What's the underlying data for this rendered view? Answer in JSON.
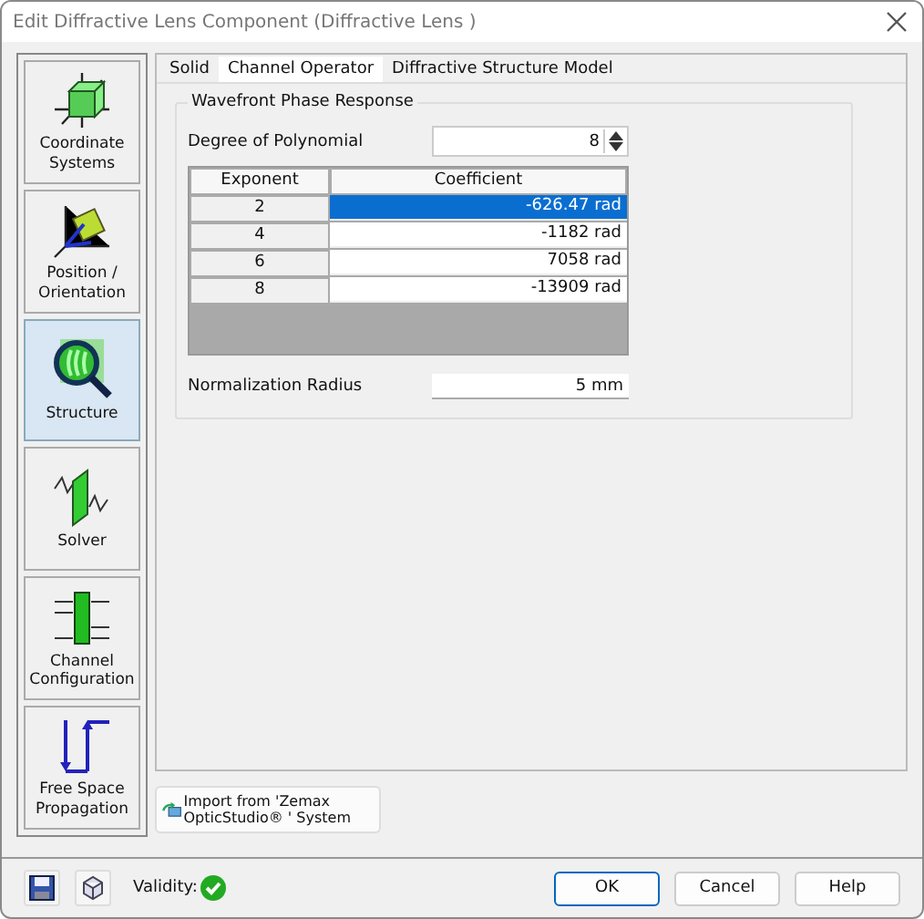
{
  "window": {
    "title": "Edit Diffractive Lens Component (Diffractive Lens )"
  },
  "sidebar": {
    "items": [
      {
        "label": "Coordinate Systems",
        "selected": false
      },
      {
        "label": "Position / Orientation",
        "selected": false
      },
      {
        "label": "Structure",
        "selected": true
      },
      {
        "label": "Solver",
        "selected": false
      },
      {
        "label": "Channel Configuration",
        "selected": false
      },
      {
        "label": "Free Space Propagation",
        "selected": false
      }
    ]
  },
  "tabs": [
    {
      "label": "Solid",
      "selected": false
    },
    {
      "label": "Channel Operator",
      "selected": true
    },
    {
      "label": "Diffractive Structure Model",
      "selected": false
    }
  ],
  "group": {
    "title": "Wavefront Phase Response",
    "degree": {
      "label": "Degree of Polynomial",
      "value": "8"
    },
    "table": {
      "columns": [
        "Exponent",
        "Coefficient"
      ],
      "rows": [
        {
          "exponent": "2",
          "coefficient": "-626.47 rad",
          "selected": true
        },
        {
          "exponent": "4",
          "coefficient": "-1182 rad",
          "selected": false
        },
        {
          "exponent": "6",
          "coefficient": "7058 rad",
          "selected": false
        },
        {
          "exponent": "8",
          "coefficient": "-13909 rad",
          "selected": false
        }
      ]
    },
    "radius": {
      "label": "Normalization Radius",
      "value": "5 mm"
    }
  },
  "import_button": {
    "label": "Import from 'Zemax OpticStudio® ' System"
  },
  "status_bar": {
    "validity_label": "Validity:",
    "valid": true
  },
  "buttons": [
    "OK",
    "Cancel",
    "Help"
  ]
}
